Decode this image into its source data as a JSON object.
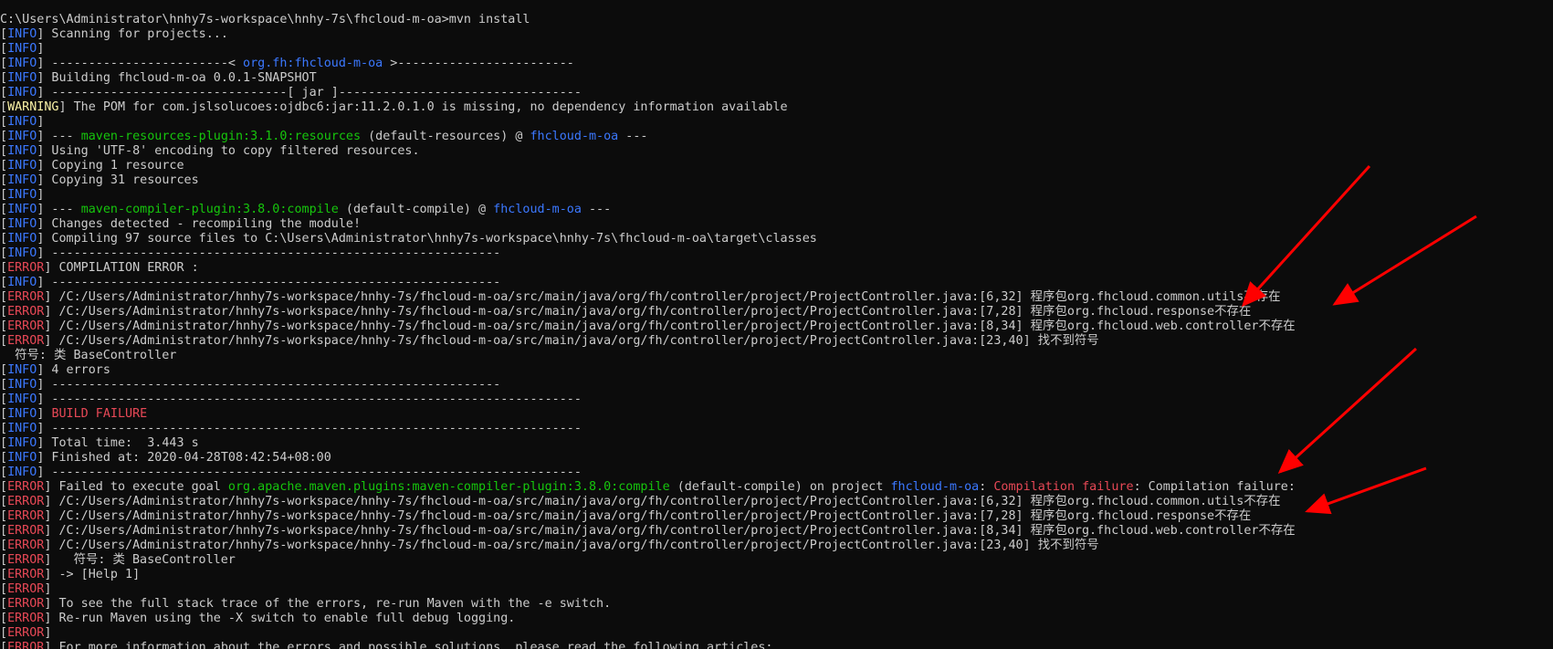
{
  "colors": {
    "background": "#0c0c0c",
    "text": "#cccccc",
    "info": "#3b78ff",
    "warning": "#f9f1a5",
    "error": "#e74856",
    "plugin": "#16c60c",
    "project": "#3b78ff",
    "arrow": "#ff0000"
  },
  "terminal": {
    "lines": [
      [
        {
          "t": "C:\\Users\\Administrator\\hnhy7s-workspace\\hnhy-7s\\fhcloud-m-oa>mvn install",
          "c": "text"
        }
      ],
      [
        {
          "t": "[",
          "c": "text"
        },
        {
          "t": "INFO",
          "c": "info"
        },
        {
          "t": "] Scanning for projects...",
          "c": "text"
        }
      ],
      [
        {
          "t": "[",
          "c": "text"
        },
        {
          "t": "INFO",
          "c": "info"
        },
        {
          "t": "]",
          "c": "text"
        }
      ],
      [
        {
          "t": "[",
          "c": "text"
        },
        {
          "t": "INFO",
          "c": "info"
        },
        {
          "t": "] ------------------------< ",
          "c": "text"
        },
        {
          "t": "org.fh:fhcloud-m-oa",
          "c": "project"
        },
        {
          "t": " >------------------------",
          "c": "text"
        }
      ],
      [
        {
          "t": "[",
          "c": "text"
        },
        {
          "t": "INFO",
          "c": "info"
        },
        {
          "t": "] Building fhcloud-m-oa 0.0.1-SNAPSHOT",
          "c": "text"
        }
      ],
      [
        {
          "t": "[",
          "c": "text"
        },
        {
          "t": "INFO",
          "c": "info"
        },
        {
          "t": "] --------------------------------[ jar ]---------------------------------",
          "c": "text"
        }
      ],
      [
        {
          "t": "[",
          "c": "text"
        },
        {
          "t": "WARNING",
          "c": "warning"
        },
        {
          "t": "] The POM for com.jslsolucoes:ojdbc6:jar:11.2.0.1.0 is missing, no dependency information available",
          "c": "text"
        }
      ],
      [
        {
          "t": "[",
          "c": "text"
        },
        {
          "t": "INFO",
          "c": "info"
        },
        {
          "t": "]",
          "c": "text"
        }
      ],
      [
        {
          "t": "[",
          "c": "text"
        },
        {
          "t": "INFO",
          "c": "info"
        },
        {
          "t": "] --- ",
          "c": "text"
        },
        {
          "t": "maven-resources-plugin:3.1.0:resources",
          "c": "plugin"
        },
        {
          "t": " (default-resources) @ ",
          "c": "text"
        },
        {
          "t": "fhcloud-m-oa",
          "c": "project"
        },
        {
          "t": " ---",
          "c": "text"
        }
      ],
      [
        {
          "t": "[",
          "c": "text"
        },
        {
          "t": "INFO",
          "c": "info"
        },
        {
          "t": "] Using 'UTF-8' encoding to copy filtered resources.",
          "c": "text"
        }
      ],
      [
        {
          "t": "[",
          "c": "text"
        },
        {
          "t": "INFO",
          "c": "info"
        },
        {
          "t": "] Copying 1 resource",
          "c": "text"
        }
      ],
      [
        {
          "t": "[",
          "c": "text"
        },
        {
          "t": "INFO",
          "c": "info"
        },
        {
          "t": "] Copying 31 resources",
          "c": "text"
        }
      ],
      [
        {
          "t": "[",
          "c": "text"
        },
        {
          "t": "INFO",
          "c": "info"
        },
        {
          "t": "]",
          "c": "text"
        }
      ],
      [
        {
          "t": "[",
          "c": "text"
        },
        {
          "t": "INFO",
          "c": "info"
        },
        {
          "t": "] --- ",
          "c": "text"
        },
        {
          "t": "maven-compiler-plugin:3.8.0:compile",
          "c": "plugin"
        },
        {
          "t": " (default-compile) @ ",
          "c": "text"
        },
        {
          "t": "fhcloud-m-oa",
          "c": "project"
        },
        {
          "t": " ---",
          "c": "text"
        }
      ],
      [
        {
          "t": "[",
          "c": "text"
        },
        {
          "t": "INFO",
          "c": "info"
        },
        {
          "t": "] Changes detected - recompiling the module!",
          "c": "text"
        }
      ],
      [
        {
          "t": "[",
          "c": "text"
        },
        {
          "t": "INFO",
          "c": "info"
        },
        {
          "t": "] Compiling 97 source files to C:\\Users\\Administrator\\hnhy7s-workspace\\hnhy-7s\\fhcloud-m-oa\\target\\classes",
          "c": "text"
        }
      ],
      [
        {
          "t": "[",
          "c": "text"
        },
        {
          "t": "INFO",
          "c": "info"
        },
        {
          "t": "] -------------------------------------------------------------",
          "c": "text"
        }
      ],
      [
        {
          "t": "[",
          "c": "text"
        },
        {
          "t": "ERROR",
          "c": "error"
        },
        {
          "t": "] COMPILATION ERROR :",
          "c": "text"
        }
      ],
      [
        {
          "t": "[",
          "c": "text"
        },
        {
          "t": "INFO",
          "c": "info"
        },
        {
          "t": "] -------------------------------------------------------------",
          "c": "text"
        }
      ],
      [
        {
          "t": "[",
          "c": "text"
        },
        {
          "t": "ERROR",
          "c": "error"
        },
        {
          "t": "] /C:/Users/Administrator/hnhy7s-workspace/hnhy-7s/fhcloud-m-oa/src/main/java/org/fh/controller/project/ProjectController.java:[6,32] 程序包org.fhcloud.common.utils不存在",
          "c": "text"
        }
      ],
      [
        {
          "t": "[",
          "c": "text"
        },
        {
          "t": "ERROR",
          "c": "error"
        },
        {
          "t": "] /C:/Users/Administrator/hnhy7s-workspace/hnhy-7s/fhcloud-m-oa/src/main/java/org/fh/controller/project/ProjectController.java:[7,28] 程序包org.fhcloud.response不存在",
          "c": "text"
        }
      ],
      [
        {
          "t": "[",
          "c": "text"
        },
        {
          "t": "ERROR",
          "c": "error"
        },
        {
          "t": "] /C:/Users/Administrator/hnhy7s-workspace/hnhy-7s/fhcloud-m-oa/src/main/java/org/fh/controller/project/ProjectController.java:[8,34] 程序包org.fhcloud.web.controller不存在",
          "c": "text"
        }
      ],
      [
        {
          "t": "[",
          "c": "text"
        },
        {
          "t": "ERROR",
          "c": "error"
        },
        {
          "t": "] /C:/Users/Administrator/hnhy7s-workspace/hnhy-7s/fhcloud-m-oa/src/main/java/org/fh/controller/project/ProjectController.java:[23,40] 找不到符号",
          "c": "text"
        }
      ],
      [
        {
          "t": "  符号: 类 BaseController",
          "c": "text"
        }
      ],
      [
        {
          "t": "[",
          "c": "text"
        },
        {
          "t": "INFO",
          "c": "info"
        },
        {
          "t": "] 4 errors",
          "c": "text"
        }
      ],
      [
        {
          "t": "[",
          "c": "text"
        },
        {
          "t": "INFO",
          "c": "info"
        },
        {
          "t": "] -------------------------------------------------------------",
          "c": "text"
        }
      ],
      [
        {
          "t": "[",
          "c": "text"
        },
        {
          "t": "INFO",
          "c": "info"
        },
        {
          "t": "] ------------------------------------------------------------------------",
          "c": "text"
        }
      ],
      [
        {
          "t": "[",
          "c": "text"
        },
        {
          "t": "INFO",
          "c": "info"
        },
        {
          "t": "] ",
          "c": "text"
        },
        {
          "t": "BUILD FAILURE",
          "c": "error"
        }
      ],
      [
        {
          "t": "[",
          "c": "text"
        },
        {
          "t": "INFO",
          "c": "info"
        },
        {
          "t": "] ------------------------------------------------------------------------",
          "c": "text"
        }
      ],
      [
        {
          "t": "[",
          "c": "text"
        },
        {
          "t": "INFO",
          "c": "info"
        },
        {
          "t": "] Total time:  3.443 s",
          "c": "text"
        }
      ],
      [
        {
          "t": "[",
          "c": "text"
        },
        {
          "t": "INFO",
          "c": "info"
        },
        {
          "t": "] Finished at: 2020-04-28T08:42:54+08:00",
          "c": "text"
        }
      ],
      [
        {
          "t": "[",
          "c": "text"
        },
        {
          "t": "INFO",
          "c": "info"
        },
        {
          "t": "] ------------------------------------------------------------------------",
          "c": "text"
        }
      ],
      [
        {
          "t": "[",
          "c": "text"
        },
        {
          "t": "ERROR",
          "c": "error"
        },
        {
          "t": "] Failed to execute goal ",
          "c": "text"
        },
        {
          "t": "org.apache.maven.plugins:maven-compiler-plugin:3.8.0:compile",
          "c": "plugin"
        },
        {
          "t": " (default-compile) on project ",
          "c": "text"
        },
        {
          "t": "fhcloud-m-oa",
          "c": "project"
        },
        {
          "t": ": ",
          "c": "text"
        },
        {
          "t": "Compilation failure",
          "c": "error"
        },
        {
          "t": ": Compilation failure:",
          "c": "text"
        }
      ],
      [
        {
          "t": "[",
          "c": "text"
        },
        {
          "t": "ERROR",
          "c": "error"
        },
        {
          "t": "] /C:/Users/Administrator/hnhy7s-workspace/hnhy-7s/fhcloud-m-oa/src/main/java/org/fh/controller/project/ProjectController.java:[6,32] 程序包org.fhcloud.common.utils不存在",
          "c": "text"
        }
      ],
      [
        {
          "t": "[",
          "c": "text"
        },
        {
          "t": "ERROR",
          "c": "error"
        },
        {
          "t": "] /C:/Users/Administrator/hnhy7s-workspace/hnhy-7s/fhcloud-m-oa/src/main/java/org/fh/controller/project/ProjectController.java:[7,28] 程序包org.fhcloud.response不存在",
          "c": "text"
        }
      ],
      [
        {
          "t": "[",
          "c": "text"
        },
        {
          "t": "ERROR",
          "c": "error"
        },
        {
          "t": "] /C:/Users/Administrator/hnhy7s-workspace/hnhy-7s/fhcloud-m-oa/src/main/java/org/fh/controller/project/ProjectController.java:[8,34] 程序包org.fhcloud.web.controller不存在",
          "c": "text"
        }
      ],
      [
        {
          "t": "[",
          "c": "text"
        },
        {
          "t": "ERROR",
          "c": "error"
        },
        {
          "t": "] /C:/Users/Administrator/hnhy7s-workspace/hnhy-7s/fhcloud-m-oa/src/main/java/org/fh/controller/project/ProjectController.java:[23,40] 找不到符号",
          "c": "text"
        }
      ],
      [
        {
          "t": "[",
          "c": "text"
        },
        {
          "t": "ERROR",
          "c": "error"
        },
        {
          "t": "]   符号: 类 BaseController",
          "c": "text"
        }
      ],
      [
        {
          "t": "[",
          "c": "text"
        },
        {
          "t": "ERROR",
          "c": "error"
        },
        {
          "t": "] -> [Help 1]",
          "c": "text"
        }
      ],
      [
        {
          "t": "[",
          "c": "text"
        },
        {
          "t": "ERROR",
          "c": "error"
        },
        {
          "t": "]",
          "c": "text"
        }
      ],
      [
        {
          "t": "[",
          "c": "text"
        },
        {
          "t": "ERROR",
          "c": "error"
        },
        {
          "t": "] To see the full stack trace of the errors, re-run Maven with the -e switch.",
          "c": "text"
        }
      ],
      [
        {
          "t": "[",
          "c": "text"
        },
        {
          "t": "ERROR",
          "c": "error"
        },
        {
          "t": "] Re-run Maven using the -X switch to enable full debug logging.",
          "c": "text"
        }
      ],
      [
        {
          "t": "[",
          "c": "text"
        },
        {
          "t": "ERROR",
          "c": "error"
        },
        {
          "t": "]",
          "c": "text"
        }
      ],
      [
        {
          "t": "[",
          "c": "text"
        },
        {
          "t": "ERROR",
          "c": "error"
        },
        {
          "t": "] For more information about the errors and possible solutions, please read the following articles:",
          "c": "text"
        }
      ]
    ]
  },
  "annotations": {
    "arrow_icon": "red-arrow-icon",
    "arrow_count": 4
  }
}
